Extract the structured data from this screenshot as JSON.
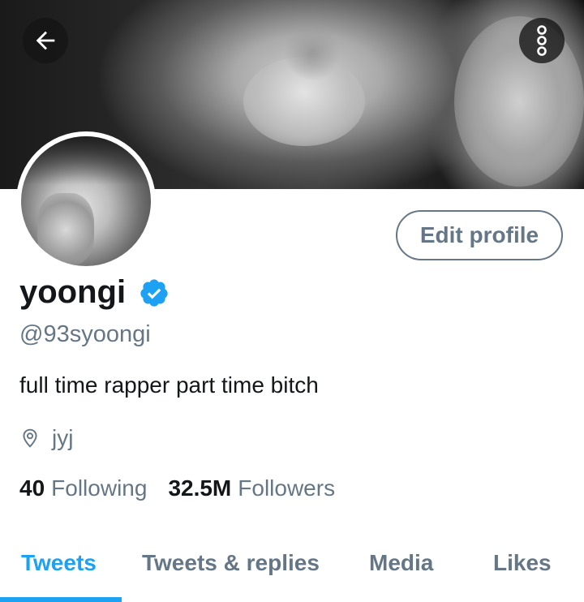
{
  "header": {
    "back_icon": "arrow-left-icon",
    "more_icon": "more-vertical-icon"
  },
  "profile": {
    "edit_label": "Edit profile",
    "name": "yoongi",
    "handle": "@93syoongi",
    "bio": "full time rapper part time bitch",
    "location": "jyj",
    "verified_color": "#1da1f2"
  },
  "stats": {
    "following_count": "40",
    "following_label": "Following",
    "followers_count": "32.5M",
    "followers_label": "Followers"
  },
  "tabs": [
    {
      "label": "Tweets",
      "active": true
    },
    {
      "label": "Tweets & replies",
      "active": false
    },
    {
      "label": "Media",
      "active": false
    },
    {
      "label": "Likes",
      "active": false
    }
  ],
  "colors": {
    "accent": "#1da1f2",
    "muted": "#657786",
    "text": "#14171a"
  }
}
